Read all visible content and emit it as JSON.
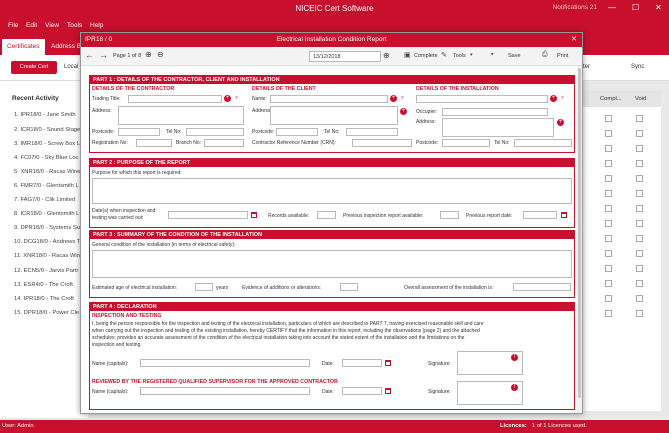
{
  "app": {
    "title": "NICEIC Cert Software",
    "notifications": "Notifications 21",
    "min": "—",
    "max": "☐",
    "close": "✕"
  },
  "menu": [
    "File",
    "Edit",
    "View",
    "Tools",
    "Help"
  ],
  "tabs": [
    "Certificates",
    "Address B"
  ],
  "toolbar": {
    "create": "Create Cert",
    "local": "Local",
    "ter": "ter",
    "sync": "Sync"
  },
  "recent": {
    "title": "Recent Activity",
    "items": [
      "1. IPR18/0 - Jane Smith",
      "2. ICR18/0 - Sound Stage",
      "3. IMR18/0 - Screw Box L",
      "4. FC07/0 - Sky Blue Loc",
      "5. XNR18/0 - Racas Wine",
      "6. FMR7/0 - Glentsmith L",
      "7. FAG7/0 - Clik Limited",
      "8. ICR18/0 - Glentsmith L",
      "9. DPR18/0 - Systems Su",
      "10. DCG18/0 - Andrews T",
      "11. XNR18/0 - Racas Wine",
      "12. ECN5/0 - Jarvis Partr",
      "13. ESR4/0 - The Croft",
      "14. IPR18/0 - The Croft",
      "15. DPR18/0 - Power Cle"
    ]
  },
  "right": {
    "col1": "Compl...",
    "col2": "Void"
  },
  "status": {
    "user": "User: Admin",
    "licences_label": "Licences:",
    "licences": "1 of 1 Licences used."
  },
  "dialog": {
    "ref": "IPR18 / 0",
    "title": "Electrical Installation Condition Report",
    "page": "Page 1 of 8",
    "date": "13/12/2018",
    "complete": "Complete",
    "tools": "Tools",
    "save": "Save",
    "print": "Print"
  },
  "part1": {
    "title": "PART 1 : DETAILS OF THE CONTRACTOR, CLIENT AND INSTALLATION",
    "contractor": "DETAILS OF THE CONTRACTOR",
    "client": "DETAILS OF THE CLIENT",
    "installation": "DETAILS OF THE INSTALLATION",
    "trading": "Trading Title:",
    "address": "Address:",
    "postcode": "Postcode:",
    "tel": "Tel No:",
    "reg": "Registration No:",
    "branch": "Branch No:",
    "name": "Name:",
    "crn": "Contractor Reference Number (CRN):",
    "occupier": "Occupier:"
  },
  "part2": {
    "title": "PART 2 : PURPOSE OF THE REPORT",
    "purpose": "Purpose for which this report is required:",
    "dates_l1": "Date(s) when inspection and",
    "dates_l2": "testing was carried out:",
    "records": "Records available:",
    "prev_avail": "Previous inspection report available:",
    "prev_date": "Previous report date:"
  },
  "part3": {
    "title": "PART 3 : SUMMARY OF THE CONDITION OF THE INSTALLATION",
    "general": "General condition of the installation (in terms of electrical safety):",
    "age": "Estimated age of electrical installation:",
    "years": "years",
    "evidence": "Evidence of additions or alterations:",
    "overall": "Overall assessment of the installation is:"
  },
  "part4": {
    "title": "PART 4 : DECLARATION",
    "inspection": "INSPECTION AND TESTING",
    "text1": "I, being the person responsible for the inspection and testing of the electrical installation, particulars of which are described in PART 7, having exercised reasonable skill and care",
    "text2": "when carrying out the inspection and testing of the existing installation, hereby CERTIFY that the information in this report, including the observations (page 2) and the attached",
    "text3": "schedules; provides an accurate assessment of the condition of the electrical installation taking into account the stated extent of the installation and the limitations on the",
    "text4": "inspection and testing.",
    "name": "Name (capitals):",
    "date": "Date:",
    "signature": "Signature:",
    "reviewed": "REVIEWED BY THE REGISTERED QUALIFIED SUPERVISOR FOR THE APPROVED CONTRACTOR"
  }
}
